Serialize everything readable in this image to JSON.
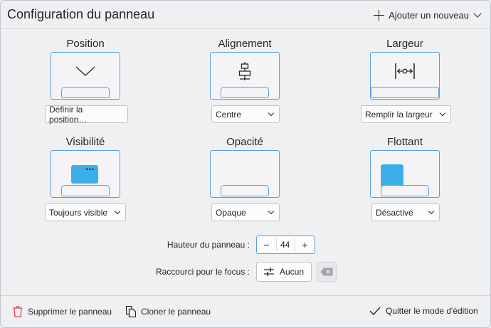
{
  "header": {
    "title": "Configuration du panneau",
    "add_label": "Ajouter un nouveau"
  },
  "sections": {
    "position": {
      "label": "Position",
      "value": "Définir la position…"
    },
    "alignment": {
      "label": "Alignement",
      "value": "Centre"
    },
    "width": {
      "label": "Largeur",
      "value": "Remplir la largeur"
    },
    "visibility": {
      "label": "Visibilité",
      "value": "Toujours visible"
    },
    "opacity": {
      "label": "Opacité",
      "value": "Opaque"
    },
    "floating": {
      "label": "Flottant",
      "value": "Désactivé"
    }
  },
  "panel_height": {
    "label": "Hauteur du panneau :",
    "value": "44",
    "decrement": "−",
    "increment": "+"
  },
  "focus_shortcut": {
    "label": "Raccourci pour le focus :",
    "value": "Aucun"
  },
  "footer": {
    "delete_label": "Supprimer le panneau",
    "clone_label": "Cloner le panneau",
    "exit_label": "Quitter le mode d'édition"
  },
  "colors": {
    "accent": "#3daee9",
    "border_accent": "#5a9ee0",
    "danger": "#da4453"
  }
}
